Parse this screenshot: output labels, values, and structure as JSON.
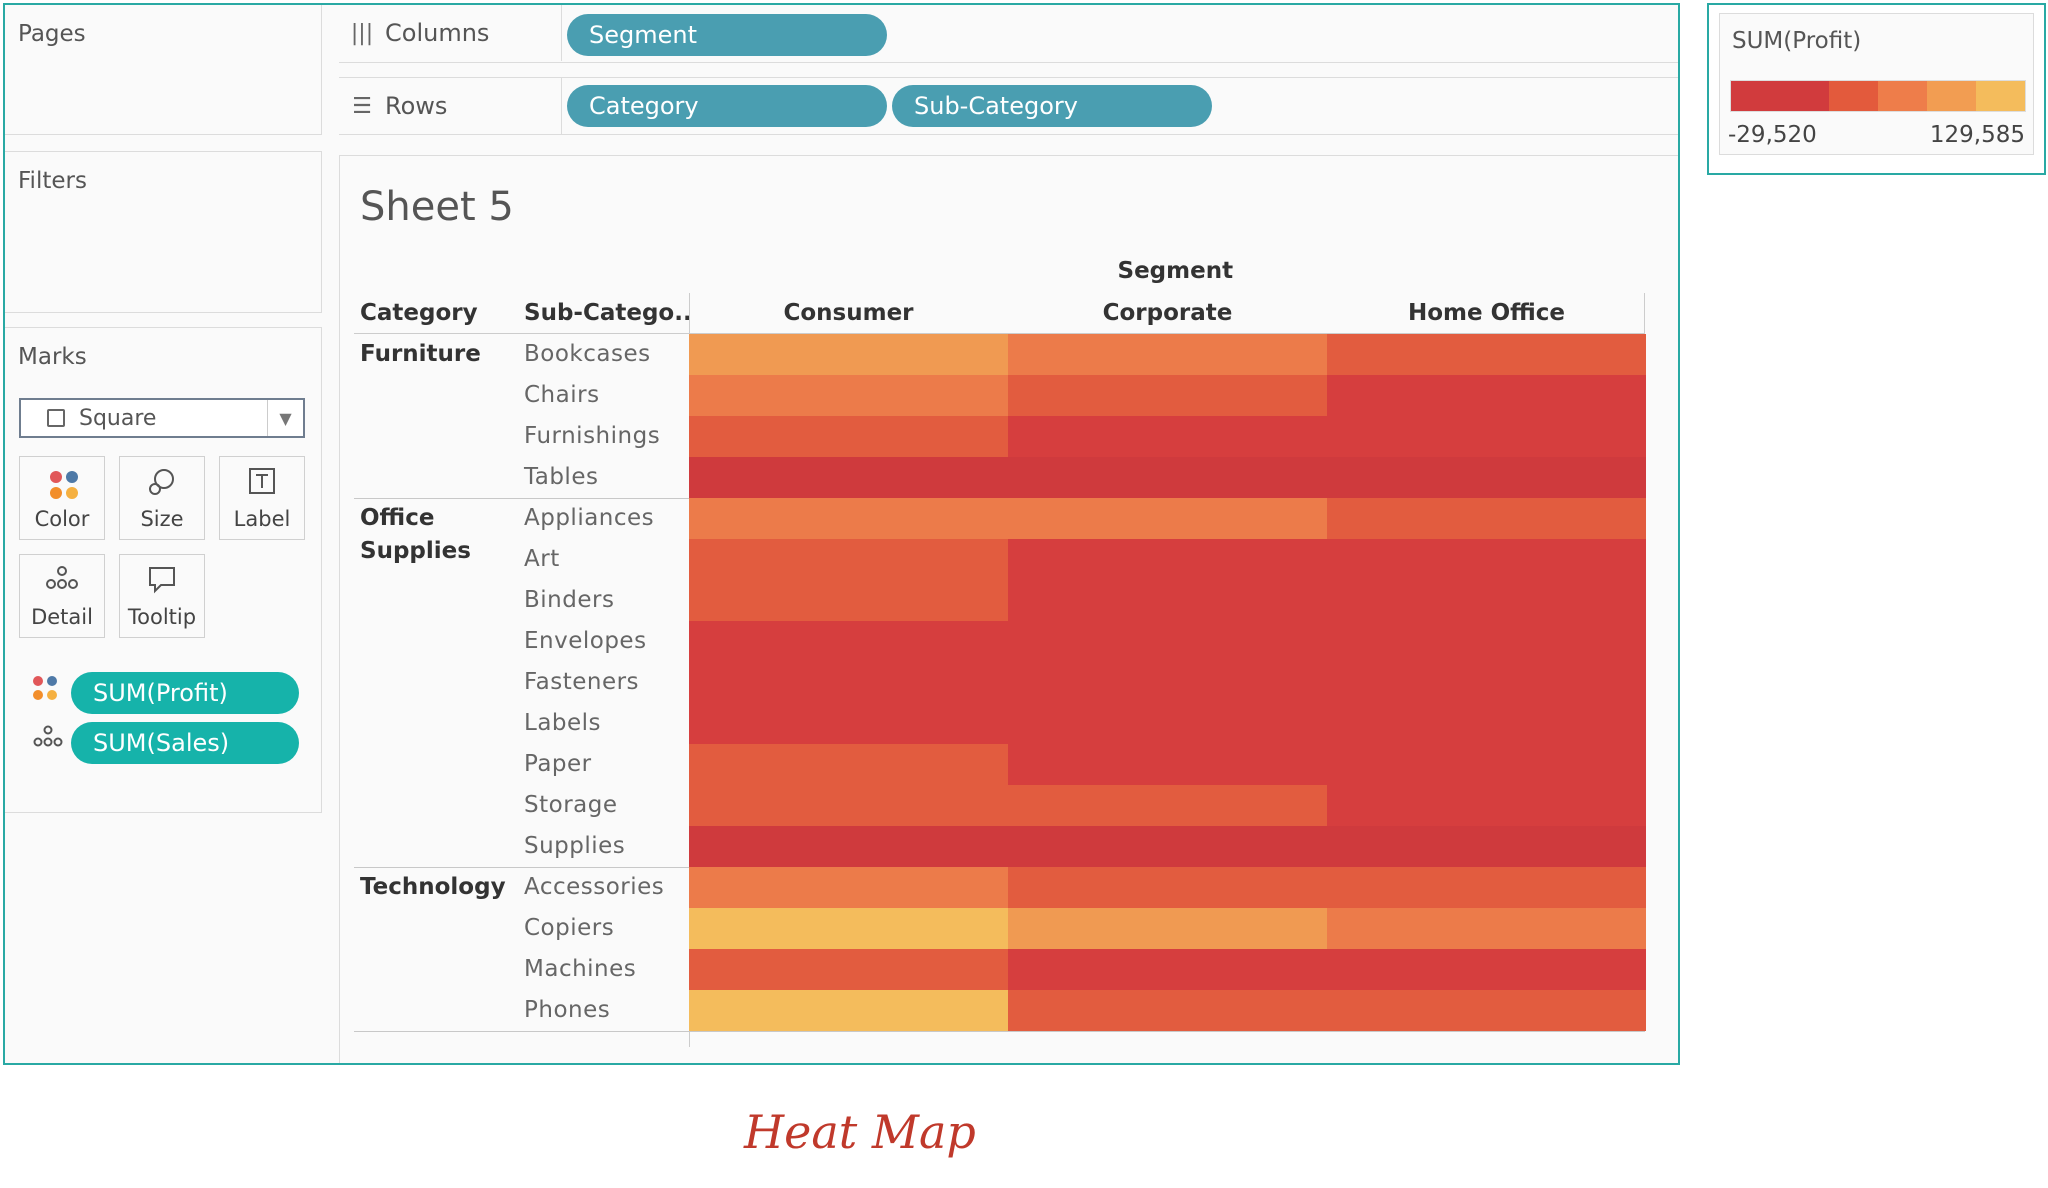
{
  "cards": {
    "pages": "Pages",
    "filters": "Filters",
    "marks": "Marks"
  },
  "shelves": {
    "columns_label": "Columns",
    "rows_label": "Rows",
    "columns_pills": [
      "Segment"
    ],
    "rows_pills": [
      "Category",
      "Sub-Category"
    ]
  },
  "marks": {
    "type": "Square",
    "buttons": {
      "color": "Color",
      "size": "Size",
      "label": "Label",
      "detail": "Detail",
      "tooltip": "Tooltip"
    },
    "fields": {
      "profit": "SUM(Profit)",
      "sales": "SUM(Sales)"
    }
  },
  "sheet": {
    "title": "Sheet 5"
  },
  "headers": {
    "segment": "Segment",
    "category": "Category",
    "subcategory": "Sub-Catego..",
    "columns": [
      "Consumer",
      "Corporate",
      "Home Office"
    ]
  },
  "legend": {
    "title": "SUM(Profit)",
    "min": "-29,520",
    "max": "129,585",
    "colors": [
      "#d13b3d",
      "#d13b3d",
      "#e35a3c",
      "#ee7d4a",
      "#f29d52",
      "#f4bc5c"
    ]
  },
  "caption": "Heat Map",
  "chart_data": {
    "type": "heatmap",
    "x": [
      "Consumer",
      "Corporate",
      "Home Office"
    ],
    "categories": [
      {
        "name": "Furniture",
        "subcategories": [
          "Bookcases",
          "Chairs",
          "Furnishings",
          "Tables"
        ]
      },
      {
        "name": "Office Supplies",
        "subcategories": [
          "Appliances",
          "Art",
          "Binders",
          "Envelopes",
          "Fasteners",
          "Labels",
          "Paper",
          "Storage",
          "Supplies"
        ]
      },
      {
        "name": "Technology",
        "subcategories": [
          "Accessories",
          "Copiers",
          "Machines",
          "Phones"
        ]
      }
    ],
    "color_levels": [
      [
        4,
        3,
        2
      ],
      [
        3,
        2,
        1
      ],
      [
        2,
        1,
        1
      ],
      [
        0,
        0,
        0
      ],
      [
        3,
        3,
        2
      ],
      [
        2,
        1,
        1
      ],
      [
        2,
        1,
        1
      ],
      [
        1,
        1,
        1
      ],
      [
        1,
        1,
        1
      ],
      [
        1,
        1,
        1
      ],
      [
        2,
        1,
        1
      ],
      [
        2,
        2,
        1
      ],
      [
        0,
        0,
        0
      ],
      [
        3,
        2,
        2
      ],
      [
        5,
        4,
        3
      ],
      [
        2,
        1,
        1
      ],
      [
        5,
        2,
        2
      ]
    ],
    "color_scale": [
      "#cf3a3d",
      "#d63e3e",
      "#e25c3f",
      "#ec7b4a",
      "#f09a52",
      "#f4bc5c"
    ],
    "color_field": "SUM(Profit)",
    "color_range": [
      -29520,
      129585
    ]
  }
}
